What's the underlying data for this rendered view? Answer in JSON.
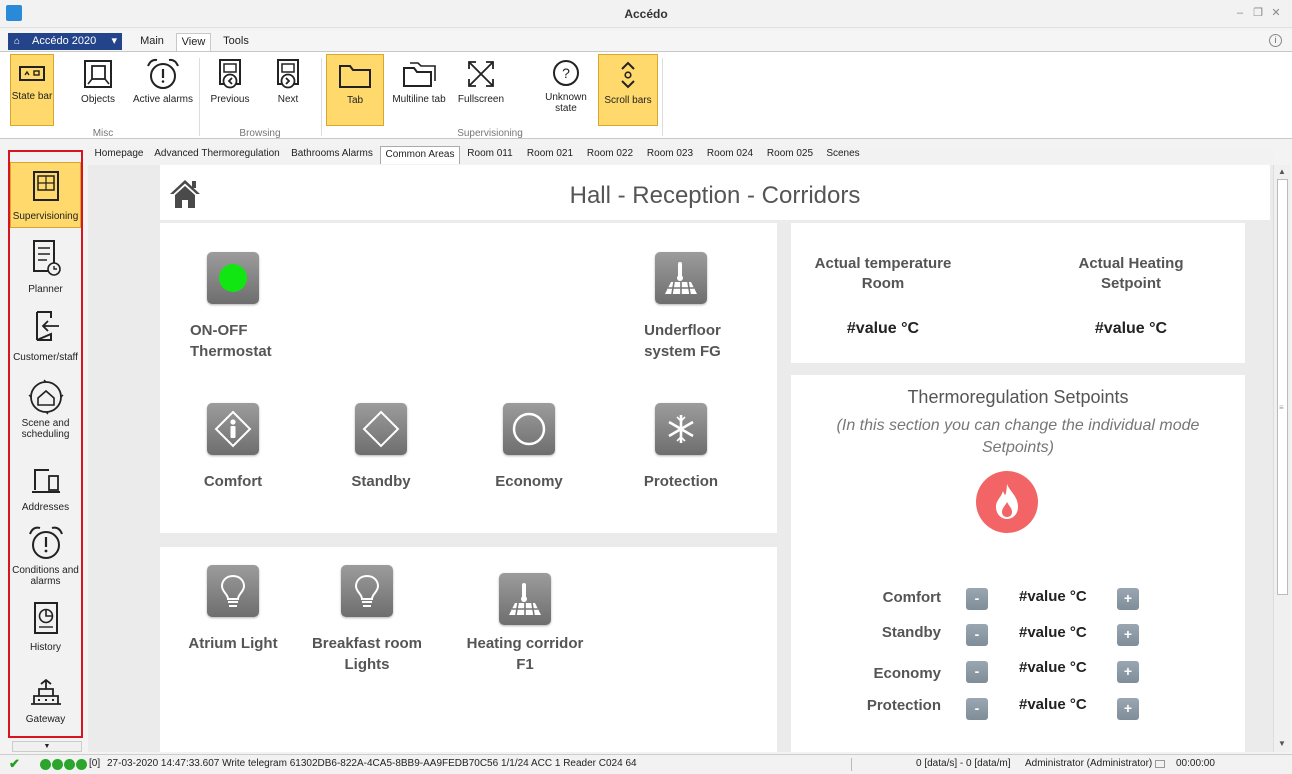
{
  "window": {
    "title": "Accédo"
  },
  "app_menu": {
    "label": "Accédo 2020"
  },
  "ribbon_tabs": [
    "Main",
    "View",
    "Tools"
  ],
  "ribbon": {
    "misc": {
      "group_label": "Misc",
      "state_bar": "State bar",
      "objects": "Objects",
      "active_alarms": "Active alarms"
    },
    "browsing": {
      "group_label": "Browsing",
      "previous": "Previous",
      "next": "Next"
    },
    "supervisioning": {
      "group_label": "Supervisioning",
      "tab": "Tab",
      "multiline_tab": "Multiline tab",
      "fullscreen": "Fullscreen",
      "unknown_state_1": "Unknown",
      "unknown_state_2": "state",
      "scroll_bars": "Scroll bars"
    }
  },
  "sidebar": [
    {
      "label": "Supervisioning",
      "icon": "supervisioning-icon",
      "selected": true
    },
    {
      "label": "Planner",
      "icon": "planner-icon"
    },
    {
      "label": "Customer/staff",
      "icon": "customer-staff-icon"
    },
    {
      "label": "Scene and",
      "label2": "scheduling",
      "icon": "scene-scheduling-icon"
    },
    {
      "label": "Addresses",
      "icon": "addresses-icon"
    },
    {
      "label": "Conditions and",
      "label2": "alarms",
      "icon": "alarm-clock-icon"
    },
    {
      "label": "History",
      "icon": "history-icon"
    },
    {
      "label": "Gateway",
      "icon": "gateway-icon"
    }
  ],
  "page_tabs": [
    "Homepage",
    "Advanced Thermoregulation",
    "Bathrooms Alarms",
    "Common Areas",
    "Room 011",
    "Room 021",
    "Room 022",
    "Room 023",
    "Room 024",
    "Room 025",
    "Scenes"
  ],
  "active_page_tab": "Common Areas",
  "page": {
    "title": "Hall - Reception - Corridors"
  },
  "controls": {
    "thermostat": {
      "line1": "ON-OFF",
      "line2": "Thermostat",
      "state_color": "#12e612"
    },
    "underfloor": {
      "line1": "Underfloor",
      "line2": "system FG"
    },
    "comfort": "Comfort",
    "standby": "Standby",
    "economy": "Economy",
    "protection": "Protection",
    "atrium_light": "Atrium Light",
    "breakfast_lights": {
      "line1": "Breakfast room",
      "line2": "Lights"
    },
    "heating_corridor": {
      "line1": "Heating corridor",
      "line2": "F1"
    }
  },
  "readings": {
    "actual_temp": {
      "line1": "Actual temperature",
      "line2": "Room",
      "value": "#value °C"
    },
    "actual_setpoint": {
      "line1": "Actual Heating",
      "line2": "Setpoint",
      "value": "#value °C"
    }
  },
  "setpoints": {
    "title": "Thermoregulation Setpoints",
    "subtitle": "(In this section you can change the individual mode Setpoints)",
    "flame_color": "#f26465",
    "minus": "-",
    "plus": "+",
    "rows": [
      {
        "label": "Comfort",
        "value": "#value °C"
      },
      {
        "label": "Standby",
        "value": "#value °C"
      },
      {
        "label": "Economy",
        "value": "#value °C"
      },
      {
        "label": "Protection",
        "value": "#value °C"
      }
    ]
  },
  "status": {
    "counter": "[0]",
    "log": "27-03-2020 14:47:33.607 Write telegram 61302DB6-822A-4CA5-8BB9-AA9FEDB70C56 1/1/24 ACC 1 Reader C024 64",
    "rate": "0 [data/s] - 0 [data/m]",
    "user": "Administrator (Administrator)",
    "time": "00:00:00"
  }
}
